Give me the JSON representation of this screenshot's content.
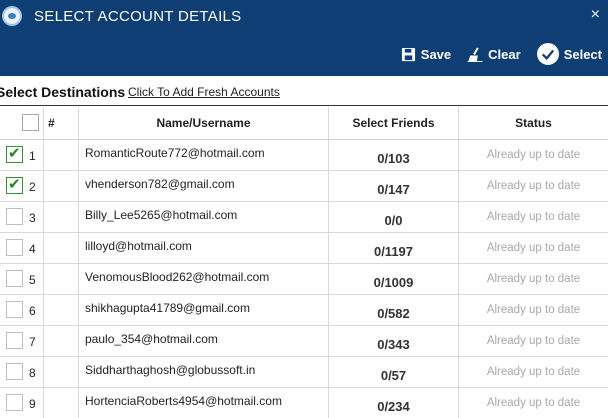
{
  "window": {
    "title": "SELECT ACCOUNT DETAILS",
    "close": "×"
  },
  "toolbar": {
    "save": "Save",
    "clear": "Clear",
    "select": "Select"
  },
  "destinations": {
    "label": "Select Destinations",
    "link": "Click To Add Fresh Accounts"
  },
  "table": {
    "headers": {
      "num": "#",
      "name": "Name/Username",
      "friends": "Select Friends",
      "status": "Status"
    },
    "rows": [
      {
        "checked": true,
        "num": "1",
        "name": "RomanticRoute772@hotmail.com",
        "friends": "0/103",
        "status": "Already up to date"
      },
      {
        "checked": true,
        "num": "2",
        "name": "vhenderson782@gmail.com",
        "friends": "0/147",
        "status": "Already up to date"
      },
      {
        "checked": false,
        "num": "3",
        "name": "Billy_Lee5265@hotmail.com",
        "friends": "0/0",
        "status": "Already up to date"
      },
      {
        "checked": false,
        "num": "4",
        "name": "lilloyd@hotmail.com",
        "friends": "0/1197",
        "status": "Already up to date"
      },
      {
        "checked": false,
        "num": "5",
        "name": "VenomousBlood262@hotmail.com",
        "friends": "0/1009",
        "status": "Already up to date"
      },
      {
        "checked": false,
        "num": "6",
        "name": "shikhagupta41789@gmail.com",
        "friends": "0/582",
        "status": "Already up to date"
      },
      {
        "checked": false,
        "num": "7",
        "name": "paulo_354@hotmail.com",
        "friends": "0/343",
        "status": "Already up to date"
      },
      {
        "checked": false,
        "num": "8",
        "name": "Siddharthaghosh@globussoft.in",
        "friends": "0/57",
        "status": "Already up to date"
      },
      {
        "checked": false,
        "num": "9",
        "name": "HortenciaRoberts4954@hotmail.com",
        "friends": "0/234",
        "status": "Already up to date"
      }
    ]
  },
  "colors": {
    "header_bg": "#0e3e73",
    "check": "#1f8a1f",
    "status_text": "#a8a8a8"
  },
  "icons": {
    "app": "app-logo-icon",
    "save": "floppy-disk-icon",
    "clear": "broom-icon",
    "select": "check-circle-icon",
    "close": "close-icon"
  }
}
